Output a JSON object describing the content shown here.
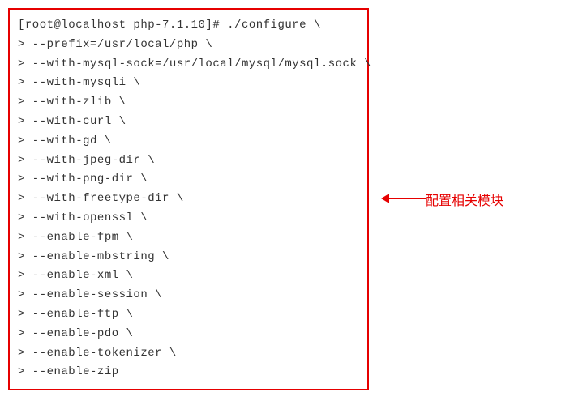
{
  "terminal": {
    "lines": [
      "[root@localhost php-7.1.10]# ./configure \\",
      "> --prefix=/usr/local/php \\",
      "> --with-mysql-sock=/usr/local/mysql/mysql.sock \\",
      "> --with-mysqli \\",
      "> --with-zlib \\",
      "> --with-curl \\",
      "> --with-gd \\",
      "> --with-jpeg-dir \\",
      "> --with-png-dir \\",
      "> --with-freetype-dir \\",
      "> --with-openssl \\",
      "> --enable-fpm \\",
      "> --enable-mbstring \\",
      "> --enable-xml \\",
      "> --enable-session \\",
      "> --enable-ftp \\",
      "> --enable-pdo \\",
      "> --enable-tokenizer \\",
      "> --enable-zip"
    ]
  },
  "annotation": {
    "label": "配置相关模块"
  }
}
